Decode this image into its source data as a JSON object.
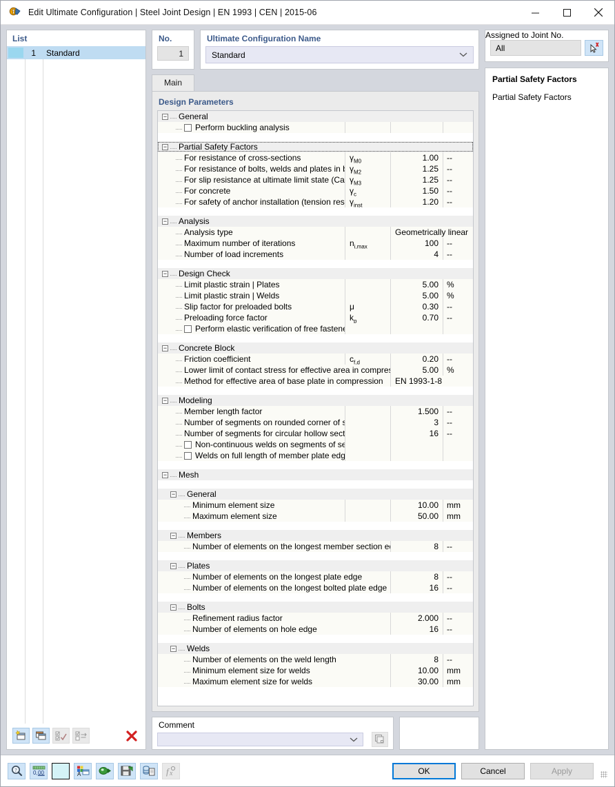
{
  "window": {
    "title": "Edit Ultimate Configuration | Steel Joint Design | EN 1993 | CEN | 2015-06",
    "minimize": "─",
    "maximize": "☐",
    "close": "✕"
  },
  "list": {
    "header": "List",
    "rows": [
      {
        "no": "1",
        "name": "Standard"
      }
    ],
    "tools": [
      {
        "name": "new-configuration-button",
        "enabled": true
      },
      {
        "name": "copy-configuration-button",
        "enabled": true
      },
      {
        "name": "select-all-button",
        "enabled": false
      },
      {
        "name": "invert-selection-button",
        "enabled": false
      },
      {
        "name": "delete-configuration-button",
        "enabled": true
      }
    ]
  },
  "no_card": {
    "header": "No.",
    "value": "1"
  },
  "name_card": {
    "header": "Ultimate Configuration Name",
    "value": "Standard"
  },
  "assigned": {
    "header": "Assigned to Joint No.",
    "value": "All"
  },
  "tabs": [
    {
      "label": "Main",
      "active": true
    }
  ],
  "design_parameters": {
    "header": "Design Parameters",
    "sections": [
      {
        "title": "General",
        "level": 1,
        "rows": [
          {
            "kind": "check",
            "label": "Perform buckling analysis",
            "checked": false,
            "symbol": "",
            "value": "",
            "unit": ""
          }
        ]
      },
      {
        "title": "Partial Safety Factors",
        "level": 1,
        "selected": true,
        "rows": [
          {
            "kind": "value",
            "label": "For resistance of cross-sections",
            "symbol": "γM0",
            "value": "1.00",
            "unit": "--"
          },
          {
            "kind": "value",
            "label": "For resistance of bolts, welds and plates in be...",
            "symbol": "γM2",
            "value": "1.25",
            "unit": "--"
          },
          {
            "kind": "value",
            "label": "For slip resistance at ultimate limit state (Categ...",
            "symbol": "γM3",
            "value": "1.25",
            "unit": "--"
          },
          {
            "kind": "value",
            "label": "For concrete",
            "symbol": "γc",
            "value": "1.50",
            "unit": "--"
          },
          {
            "kind": "value",
            "label": "For safety of anchor installation (tension resist...",
            "symbol": "γinst",
            "value": "1.20",
            "unit": "--"
          }
        ]
      },
      {
        "title": "Analysis",
        "level": 1,
        "rows": [
          {
            "kind": "text",
            "label": "Analysis type",
            "symbol": "",
            "value": "Geometrically linear",
            "unit": ""
          },
          {
            "kind": "value",
            "label": "Maximum number of iterations",
            "symbol": "ni,max",
            "value": "100",
            "unit": "--"
          },
          {
            "kind": "value",
            "label": "Number of load increments",
            "symbol": "",
            "value": "4",
            "unit": "--"
          }
        ]
      },
      {
        "title": "Design Check",
        "level": 1,
        "rows": [
          {
            "kind": "value",
            "label": "Limit plastic strain | Plates",
            "symbol": "",
            "value": "5.00",
            "unit": "%"
          },
          {
            "kind": "value",
            "label": "Limit plastic strain | Welds",
            "symbol": "",
            "value": "5.00",
            "unit": "%"
          },
          {
            "kind": "value",
            "label": "Slip factor for preloaded bolts",
            "symbol": "μ",
            "value": "0.30",
            "unit": "--"
          },
          {
            "kind": "value",
            "label": "Preloading force factor",
            "symbol": "kp",
            "value": "0.70",
            "unit": "--"
          },
          {
            "kind": "check",
            "label": "Perform elastic verification of free fastener shank",
            "checked": false,
            "symbol": "",
            "value": "",
            "unit": ""
          }
        ]
      },
      {
        "title": "Concrete Block",
        "level": 1,
        "rows": [
          {
            "kind": "value",
            "label": "Friction coefficient",
            "symbol": "cf,d",
            "value": "0.20",
            "unit": "--"
          },
          {
            "kind": "valuewide",
            "label": "Lower limit of contact stress for effective area in compression",
            "symbol": "",
            "value": "5.00",
            "unit": "%"
          },
          {
            "kind": "textwide",
            "label": "Method for effective area of base plate in compression",
            "symbol": "",
            "value": "EN 1993-1-8",
            "unit": ""
          }
        ]
      },
      {
        "title": "Modeling",
        "level": 1,
        "rows": [
          {
            "kind": "value",
            "label": "Member length factor",
            "symbol": "",
            "value": "1.500",
            "unit": "--"
          },
          {
            "kind": "value",
            "label": "Number of segments on rounded corner of section",
            "symbol": "",
            "value": "3",
            "unit": "--"
          },
          {
            "kind": "value",
            "label": "Number of segments for circular hollow section",
            "symbol": "",
            "value": "16",
            "unit": "--"
          },
          {
            "kind": "check",
            "label": "Non-continuous welds on segments of sections",
            "checked": false,
            "symbol": "",
            "value": "",
            "unit": ""
          },
          {
            "kind": "check",
            "label": "Welds on full length of member plate edge",
            "checked": false,
            "symbol": "",
            "value": "",
            "unit": ""
          }
        ]
      },
      {
        "title": "Mesh",
        "level": 1,
        "rows": []
      },
      {
        "title": "General",
        "level": 2,
        "rows": [
          {
            "kind": "value",
            "label": "Minimum element size",
            "symbol": "",
            "value": "10.00",
            "unit": "mm"
          },
          {
            "kind": "value",
            "label": "Maximum element size",
            "symbol": "",
            "value": "50.00",
            "unit": "mm"
          }
        ]
      },
      {
        "title": "Members",
        "level": 2,
        "rows": [
          {
            "kind": "valuewide2",
            "label": "Number of elements on the longest member section edge",
            "symbol": "",
            "value": "8",
            "unit": "--"
          }
        ]
      },
      {
        "title": "Plates",
        "level": 2,
        "rows": [
          {
            "kind": "valuewide2",
            "label": "Number of elements on the longest plate edge",
            "symbol": "",
            "value": "8",
            "unit": "--"
          },
          {
            "kind": "valuewide2",
            "label": "Number of elements on the longest bolted plate edge",
            "symbol": "",
            "value": "16",
            "unit": "--"
          }
        ]
      },
      {
        "title": "Bolts",
        "level": 2,
        "rows": [
          {
            "kind": "valuewide2",
            "label": "Refinement radius factor",
            "symbol": "",
            "value": "2.000",
            "unit": "--"
          },
          {
            "kind": "valuewide2",
            "label": "Number of elements on hole edge",
            "symbol": "",
            "value": "16",
            "unit": "--"
          }
        ]
      },
      {
        "title": "Welds",
        "level": 2,
        "rows": [
          {
            "kind": "valuewide2",
            "label": "Number of elements on the weld length",
            "symbol": "",
            "value": "8",
            "unit": "--"
          },
          {
            "kind": "valuewide2",
            "label": "Minimum element size for welds",
            "symbol": "",
            "value": "10.00",
            "unit": "mm"
          },
          {
            "kind": "valuewide2",
            "label": "Maximum element size for welds",
            "symbol": "",
            "value": "30.00",
            "unit": "mm"
          }
        ]
      }
    ]
  },
  "comment": {
    "header": "Comment",
    "value": ""
  },
  "info": {
    "title": "Partial Safety Factors",
    "text": "Partial Safety Factors"
  },
  "footer": {
    "tools": [
      {
        "name": "search-icon-button",
        "enabled": true
      },
      {
        "name": "units-decimal-places-button",
        "enabled": true
      },
      {
        "name": "color-swatch-button",
        "enabled": true
      },
      {
        "name": "display-properties-button",
        "enabled": true
      },
      {
        "name": "import-button",
        "enabled": true
      },
      {
        "name": "save-button",
        "enabled": true
      },
      {
        "name": "database-export-button",
        "enabled": true
      },
      {
        "name": "formula-button",
        "enabled": false
      }
    ],
    "ok": "OK",
    "cancel": "Cancel",
    "apply": "Apply"
  }
}
